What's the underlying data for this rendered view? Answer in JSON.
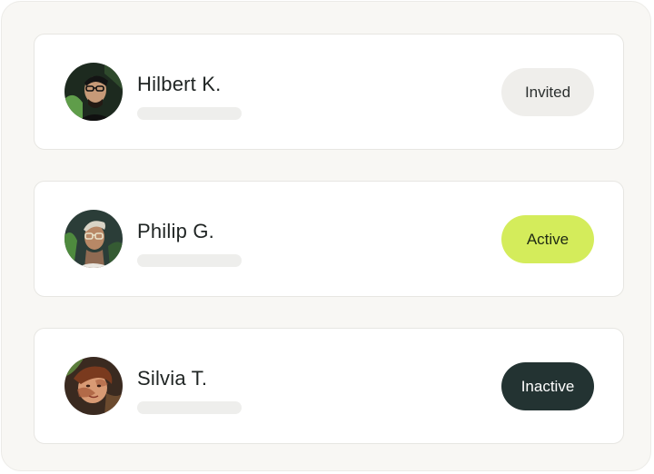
{
  "members": [
    {
      "name": "Hilbert K.",
      "status": "Invited",
      "status_color": "#efeeeb",
      "avatar_icon": "avatar-photo-icon"
    },
    {
      "name": "Philip G.",
      "status": "Active",
      "status_color": "#d4ec5b",
      "avatar_icon": "avatar-photo-icon"
    },
    {
      "name": "Silvia T.",
      "status": "Inactive",
      "status_color": "#233332",
      "avatar_icon": "avatar-photo-icon"
    }
  ]
}
